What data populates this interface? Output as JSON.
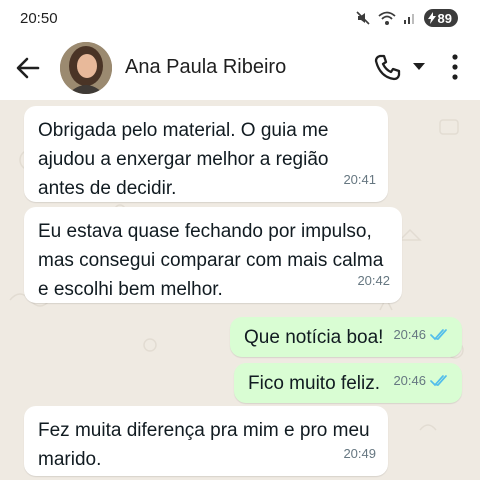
{
  "status_bar": {
    "time": "20:50",
    "battery": "89"
  },
  "header": {
    "contact_name": "Ana Paula Ribeiro"
  },
  "messages": [
    {
      "direction": "in",
      "text": "Obrigada pelo material. O guia me ajudou a enxergar melhor a região antes de decidir.",
      "time": "20:41"
    },
    {
      "direction": "in",
      "text": "Eu estava quase fechando por impulso, mas consegui comparar com mais calma e escolhi bem melhor.",
      "time": "20:42"
    },
    {
      "direction": "out",
      "text": "Que notícia boa!",
      "time": "20:46",
      "status": "read"
    },
    {
      "direction": "out",
      "text": "Fico muito feliz.",
      "time": "20:46",
      "status": "read"
    },
    {
      "direction": "in",
      "text": "Fez muita diferença pra mim e pro meu marido.",
      "time": "20:49"
    }
  ],
  "icons": {
    "back": "arrow-left-icon",
    "call": "phone-icon",
    "call_options": "caret-down-icon",
    "menu": "more-vertical-icon",
    "read_receipt": "double-check-icon"
  },
  "colors": {
    "chat_background": "#efeae2",
    "incoming_bubble": "#ffffff",
    "outgoing_bubble": "#d9fdd3",
    "read_ticks": "#53bdeb"
  }
}
